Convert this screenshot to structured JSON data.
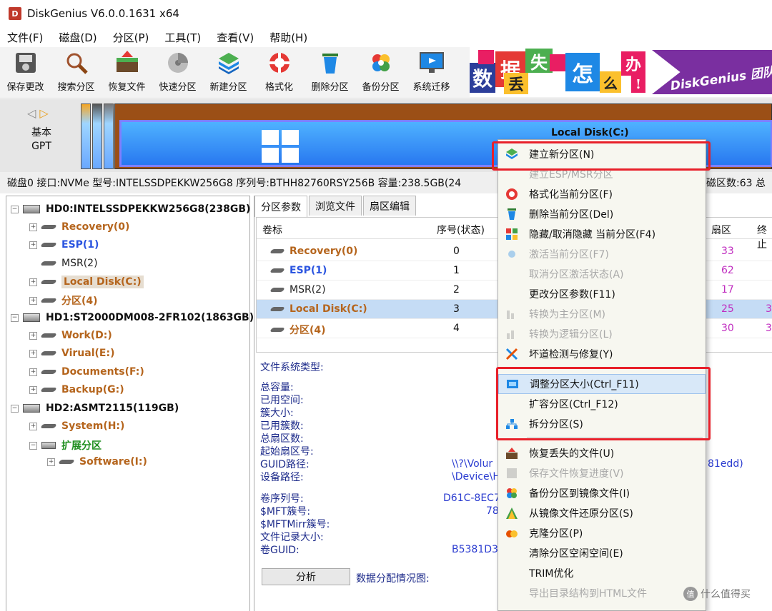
{
  "app": {
    "title": "DiskGenius V6.0.0.1631 x64",
    "logo_letter": "D"
  },
  "menu": [
    "文件(F)",
    "磁盘(D)",
    "分区(P)",
    "工具(T)",
    "查看(V)",
    "帮助(H)"
  ],
  "toolbar": [
    {
      "label": "保存更改",
      "icon": "save-icon"
    },
    {
      "label": "搜索分区",
      "icon": "search-icon"
    },
    {
      "label": "恢复文件",
      "icon": "recover-files-icon"
    },
    {
      "label": "快速分区",
      "icon": "quick-partition-icon"
    },
    {
      "label": "新建分区",
      "icon": "new-partition-icon"
    },
    {
      "label": "格式化",
      "icon": "format-icon"
    },
    {
      "label": "删除分区",
      "icon": "delete-partition-icon"
    },
    {
      "label": "备份分区",
      "icon": "backup-partition-icon"
    },
    {
      "label": "系统迁移",
      "icon": "system-migration-icon"
    }
  ],
  "banner": {
    "chars": [
      "数",
      "据",
      "丢",
      "失",
      "怎",
      "么",
      "办",
      "!"
    ],
    "slogan": "DiskGenius 团队"
  },
  "diskmap": {
    "type_line1": "基本",
    "type_line2": "GPT",
    "partition_name": "Local Disk(C:)"
  },
  "infobar": "磁盘0 接口:NVMe  型号:INTELSSDPEKKW256G8  序列号:BTHH82760RSY256B  容量:238.5GB(24",
  "infobar_right": "磁区数:63  总",
  "tree": {
    "disks": [
      {
        "label": "HD0:INTELSSDPEKKW256G8(238GB)",
        "partitions": [
          {
            "label": "Recovery(0)",
            "color": "orange"
          },
          {
            "label": "ESP(1)",
            "color": "blue"
          },
          {
            "label": "MSR(2)",
            "color": "gray"
          },
          {
            "label": "Local Disk(C:)",
            "color": "orange"
          },
          {
            "label": "分区(4)",
            "color": "orange"
          }
        ]
      },
      {
        "label": "HD1:ST2000DM008-2FR102(1863GB)",
        "partitions": [
          {
            "label": "Work(D:)",
            "color": "orange"
          },
          {
            "label": "Virual(E:)",
            "color": "orange"
          },
          {
            "label": "Documents(F:)",
            "color": "orange"
          },
          {
            "label": "Backup(G:)",
            "color": "orange"
          }
        ]
      },
      {
        "label": "HD2:ASMT2115(119GB)",
        "partitions": [
          {
            "label": "System(H:)",
            "color": "orange"
          },
          {
            "label": "扩展分区",
            "color": "green"
          },
          {
            "label": "Software(I:)",
            "color": "orange"
          }
        ]
      }
    ]
  },
  "tabs": [
    "分区参数",
    "浏览文件",
    "扇区编辑"
  ],
  "partition_table": {
    "headers": {
      "volume": "卷标",
      "index": "序号(状态)",
      "sector": "扇区",
      "end": "终止"
    },
    "rows": [
      {
        "name": "Recovery(0)",
        "color": "orange",
        "index": "0",
        "sector": "33",
        "end": ""
      },
      {
        "name": "ESP(1)",
        "color": "blue",
        "index": "1",
        "sector": "62",
        "end": ""
      },
      {
        "name": "MSR(2)",
        "color": "gray",
        "index": "2",
        "sector": "17",
        "end": ""
      },
      {
        "name": "Local Disk(C:)",
        "color": "orange",
        "index": "3",
        "sector": "25",
        "end": "3"
      },
      {
        "name": "分区(4)",
        "color": "orange",
        "index": "4",
        "sector": "30",
        "end": "3"
      }
    ]
  },
  "details": {
    "fs_type_label": "文件系统类型:",
    "group1": [
      "总容量:",
      "已用空间:",
      "簇大小:",
      "已用簇数:",
      "总扇区数:",
      "起始扇区号:",
      "GUID路径:",
      "设备路径:"
    ],
    "guid_path_value": "\\\\?\\Volur",
    "device_path_value": "\\Device\\H",
    "guid_tail": "81edd)",
    "group2": [
      "卷序列号:",
      "$MFT簇号:",
      "$MFTMirr簇号:",
      "文件记录大小:",
      "卷GUID:"
    ],
    "serial_value": "D61C-8EC7",
    "mft_value": "78",
    "vol_guid_value": "B5381D3",
    "analyze_button": "分析",
    "analyze_label": "数据分配情况图:"
  },
  "context_menu": [
    {
      "label": "建立新分区(N)",
      "icon": "new-partition-icon",
      "disabled": false
    },
    {
      "label": "建立ESP/MSR分区",
      "icon": "esp-icon",
      "disabled": true
    },
    {
      "label": "格式化当前分区(F)",
      "icon": "format-icon",
      "disabled": false
    },
    {
      "label": "删除当前分区(Del)",
      "icon": "delete-icon",
      "disabled": false
    },
    {
      "label": "隐藏/取消隐藏 当前分区(F4)",
      "icon": "hide-icon",
      "disabled": false
    },
    {
      "label": "激活当前分区(F7)",
      "icon": "activate-icon",
      "disabled": true
    },
    {
      "label": "取消分区激活状态(A)",
      "icon": "deactivate-icon",
      "disabled": true
    },
    {
      "label": "更改分区参数(F11)",
      "icon": "params-icon",
      "disabled": false
    },
    {
      "label": "转换为主分区(M)",
      "icon": "to-primary-icon",
      "disabled": true
    },
    {
      "label": "转换为逻辑分区(L)",
      "icon": "to-logical-icon",
      "disabled": true
    },
    {
      "label": "坏道检测与修复(Y)",
      "icon": "repair-icon",
      "disabled": false
    },
    {
      "label": "调整分区大小(Ctrl_F11)",
      "icon": "resize-icon",
      "disabled": false,
      "highlighted": true
    },
    {
      "label": "扩容分区(Ctrl_F12)",
      "icon": "extend-icon",
      "disabled": false
    },
    {
      "label": "拆分分区(S)",
      "icon": "split-icon",
      "disabled": false
    },
    {
      "label": "恢复丢失的文件(U)",
      "icon": "restore-files-icon",
      "disabled": false
    },
    {
      "label": "保存文件恢复进度(V)",
      "icon": "save-progress-icon",
      "disabled": true
    },
    {
      "label": "备份分区到镜像文件(I)",
      "icon": "backup-image-icon",
      "disabled": false
    },
    {
      "label": "从镜像文件还原分区(S)",
      "icon": "restore-image-icon",
      "disabled": false
    },
    {
      "label": "克隆分区(P)",
      "icon": "clone-icon",
      "disabled": false
    },
    {
      "label": "清除分区空闲空间(E)",
      "icon": "wipe-icon",
      "disabled": false
    },
    {
      "label": "TRIM优化",
      "icon": "trim-icon",
      "disabled": false
    },
    {
      "label": "导出目录结构到HTML文件",
      "icon": "export-icon",
      "disabled": true
    }
  ],
  "watermark": {
    "text": "什么值得买",
    "icon_letter": "值"
  },
  "colors": {
    "accent_red": "#e8202a",
    "orange": "#b5651d",
    "blue": "#2b55e0",
    "green": "#1e8e1e",
    "sector_magenta": "#c02ec0"
  }
}
